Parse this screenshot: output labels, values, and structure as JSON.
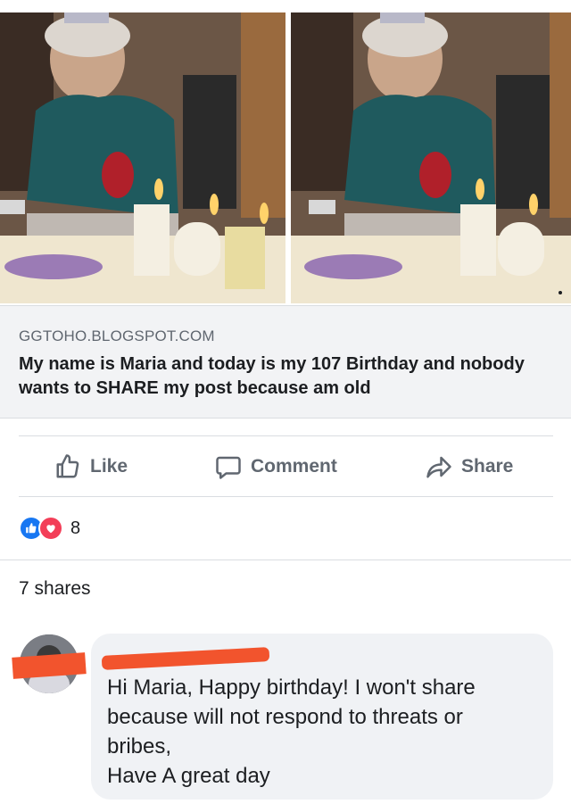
{
  "post": {
    "link_domain": "GGTOHO.BLOGSPOT.COM",
    "link_title": "My name is Maria and today is my 107 Birthday and nobody wants to SHARE my post because am old"
  },
  "actions": {
    "like_label": "Like",
    "comment_label": "Comment",
    "share_label": "Share"
  },
  "reactions": {
    "count": "8",
    "types": [
      "like-icon",
      "love-icon"
    ]
  },
  "shares_text": "7 shares",
  "comment": {
    "author": "",
    "text": "Hi Maria, Happy birthday! I won't share\nbecause will not respond to threats or\nbribes,\nHave A great day"
  },
  "colors": {
    "like_blue": "#1877f2",
    "love_red": "#f33e58",
    "redaction": "#f2542d",
    "muted_text": "#606770"
  }
}
